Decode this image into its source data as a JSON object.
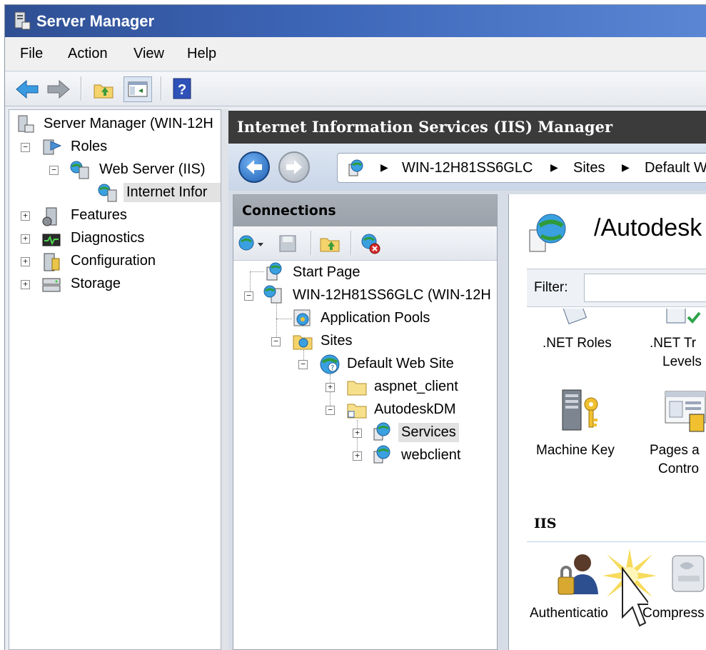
{
  "window": {
    "title": "Server Manager"
  },
  "menu": [
    "File",
    "Action",
    "View",
    "Help"
  ],
  "left_tree": {
    "root": "Server Manager (WIN-12H",
    "roles": "Roles",
    "web_server": "Web Server (IIS)",
    "iis_node": "Internet Infor",
    "features": "Features",
    "diagnostics": "Diagnostics",
    "configuration": "Configuration",
    "storage": "Storage"
  },
  "iis": {
    "header": "Internet Information Services (IIS) Manager",
    "breadcrumb": [
      "WIN-12H81SS6GLC",
      "Sites",
      "Default W"
    ]
  },
  "connections": {
    "title": "Connections",
    "tree": {
      "start_page": "Start Page",
      "server": "WIN-12H81SS6GLC (WIN-12H",
      "app_pools": "Application Pools",
      "sites": "Sites",
      "default_site": "Default Web Site",
      "aspnet_client": "aspnet_client",
      "autodeskdm": "AutodeskDM",
      "services": "Services",
      "webclient": "webclient"
    }
  },
  "features": {
    "title": "/Autodesk",
    "filter_label": "Filter:",
    "items": {
      "net_roles": ".NET Roles",
      "net_trust_1": ".NET Tr",
      "net_trust_2": "Levels",
      "machine_key": "Machine Key",
      "pages_1": "Pages a",
      "pages_2": "Contro",
      "authentication": "Authenticatio",
      "compression": "Compress"
    },
    "group_iis": "IIS"
  },
  "colors": {
    "title_bar": "#2f4f93",
    "iis_header": "#3b3b3b",
    "selection": "#e2e2e2"
  }
}
